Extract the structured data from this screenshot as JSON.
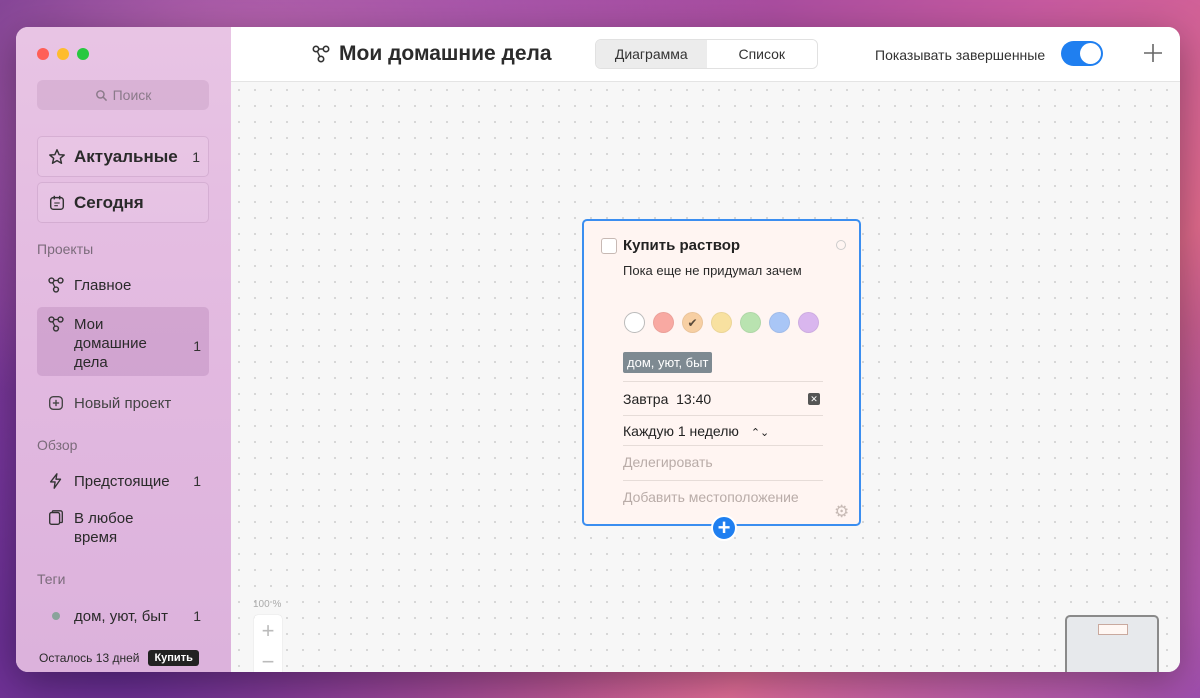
{
  "sidebar": {
    "search_placeholder": "Поиск",
    "favorites": [
      {
        "label": "Актуальные",
        "count": "1"
      },
      {
        "label": "Сегодня",
        "count": ""
      }
    ],
    "projects_label": "Проекты",
    "projects": [
      {
        "label": "Главное",
        "count": ""
      },
      {
        "label": "Мои домашние дела",
        "count": "1"
      }
    ],
    "new_project": "Новый проект",
    "overview_label": "Обзор",
    "overview": [
      {
        "label": "Предстоящие",
        "count": "1"
      },
      {
        "label": "В любое время",
        "count": ""
      }
    ],
    "tags_label": "Теги",
    "tags": [
      {
        "label": "дом, уют, быт",
        "count": "1"
      }
    ],
    "trial_text": "Осталось 13 дней",
    "buy_label": "Купить"
  },
  "toolbar": {
    "title": "Мои домашние дела",
    "tabs": [
      "Диаграмма",
      "Список"
    ],
    "selected_tab": "Диаграмма",
    "show_completed_label": "Показывать завершенные",
    "show_completed": true
  },
  "task_card": {
    "title": "Купить раствор",
    "note": "Пока еще не придумал зачем",
    "colors": [
      "#ffffff",
      "#f8a9a2",
      "#f7cfa3",
      "#f8e1a0",
      "#b9e3b0",
      "#a9c6f6",
      "#d9b6ee"
    ],
    "selected_color": "#f7cfa3",
    "tag": "дом, уют, быт",
    "date": "Завтра",
    "time": "13:40",
    "repeat": "Каждую 1 неделю",
    "delegate_placeholder": "Делегировать",
    "location_placeholder": "Добавить местоположение"
  },
  "canvas": {
    "zoom": "100 %"
  },
  "colors": {
    "accent": "#1f7ff0",
    "tag_chip": "#7e8a92"
  }
}
